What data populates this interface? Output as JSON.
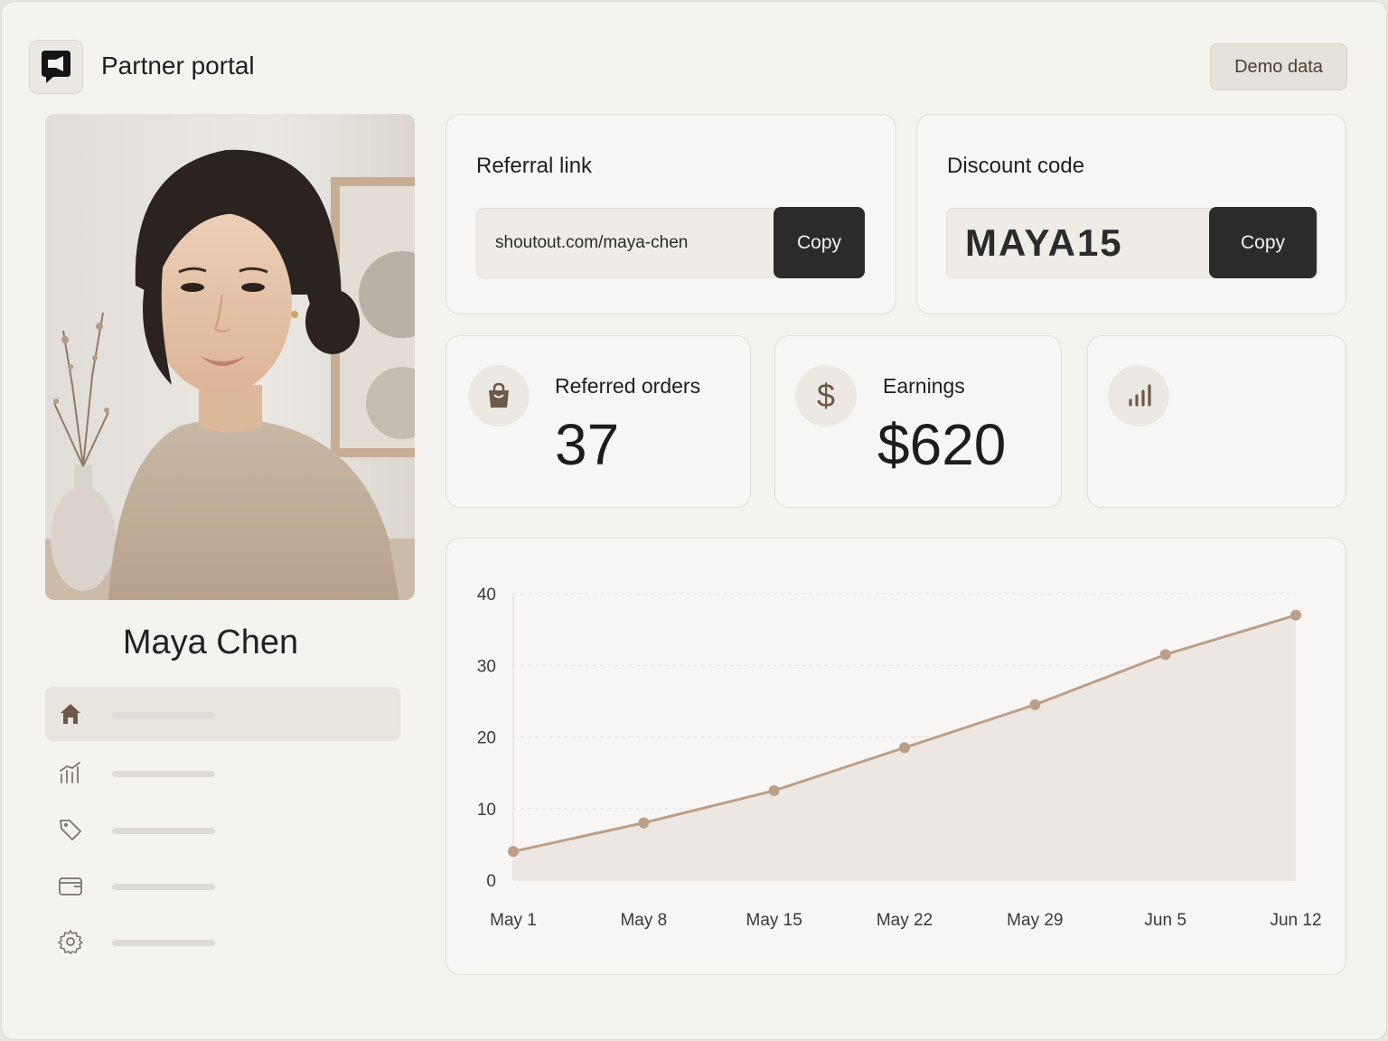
{
  "app": {
    "title": "Partner portal",
    "demo_label": "Demo data"
  },
  "profile": {
    "name": "Maya Chen"
  },
  "sidebar": {
    "items": [
      {
        "icon": "home-icon",
        "active": true
      },
      {
        "icon": "analytics-icon",
        "active": false
      },
      {
        "icon": "tag-icon",
        "active": false
      },
      {
        "icon": "wallet-icon",
        "active": false
      },
      {
        "icon": "settings-icon",
        "active": false
      }
    ]
  },
  "referral": {
    "title": "Referral link",
    "value": "shoutout.com/maya-chen",
    "copy_label": "Copy"
  },
  "discount": {
    "title": "Discount code",
    "value": "MAYA15",
    "copy_label": "Copy"
  },
  "stats": {
    "orders": {
      "label": "Referred orders",
      "value": "37",
      "icon": "shopping-bag-icon"
    },
    "earnings": {
      "label": "Earnings",
      "value": "$620",
      "icon": "dollar-icon"
    },
    "third": {
      "icon": "bar-chart-icon"
    }
  },
  "colors": {
    "accent": "#bd9f87",
    "dark_button": "#2c2b29",
    "background": "#f5f3f0"
  },
  "chart_data": {
    "type": "area",
    "x": [
      "May 1",
      "May 8",
      "May 15",
      "May 22",
      "May 29",
      "Jun 5",
      "Jun 12"
    ],
    "points": [
      {
        "x": "May 1",
        "y": 4
      },
      {
        "x": "May 8",
        "y": 8
      },
      {
        "x": "May 15",
        "y": 12.5
      },
      {
        "x": "May 22",
        "y": 18.5
      },
      {
        "x": "May 29",
        "y": 24.5
      },
      {
        "x": "Jun 5",
        "y": 31.5
      },
      {
        "x": "Jun 12",
        "y": 37
      }
    ],
    "yticks": [
      0,
      10,
      20,
      30,
      40
    ],
    "ylim": [
      0,
      40
    ],
    "grid": true,
    "legend": "none"
  }
}
